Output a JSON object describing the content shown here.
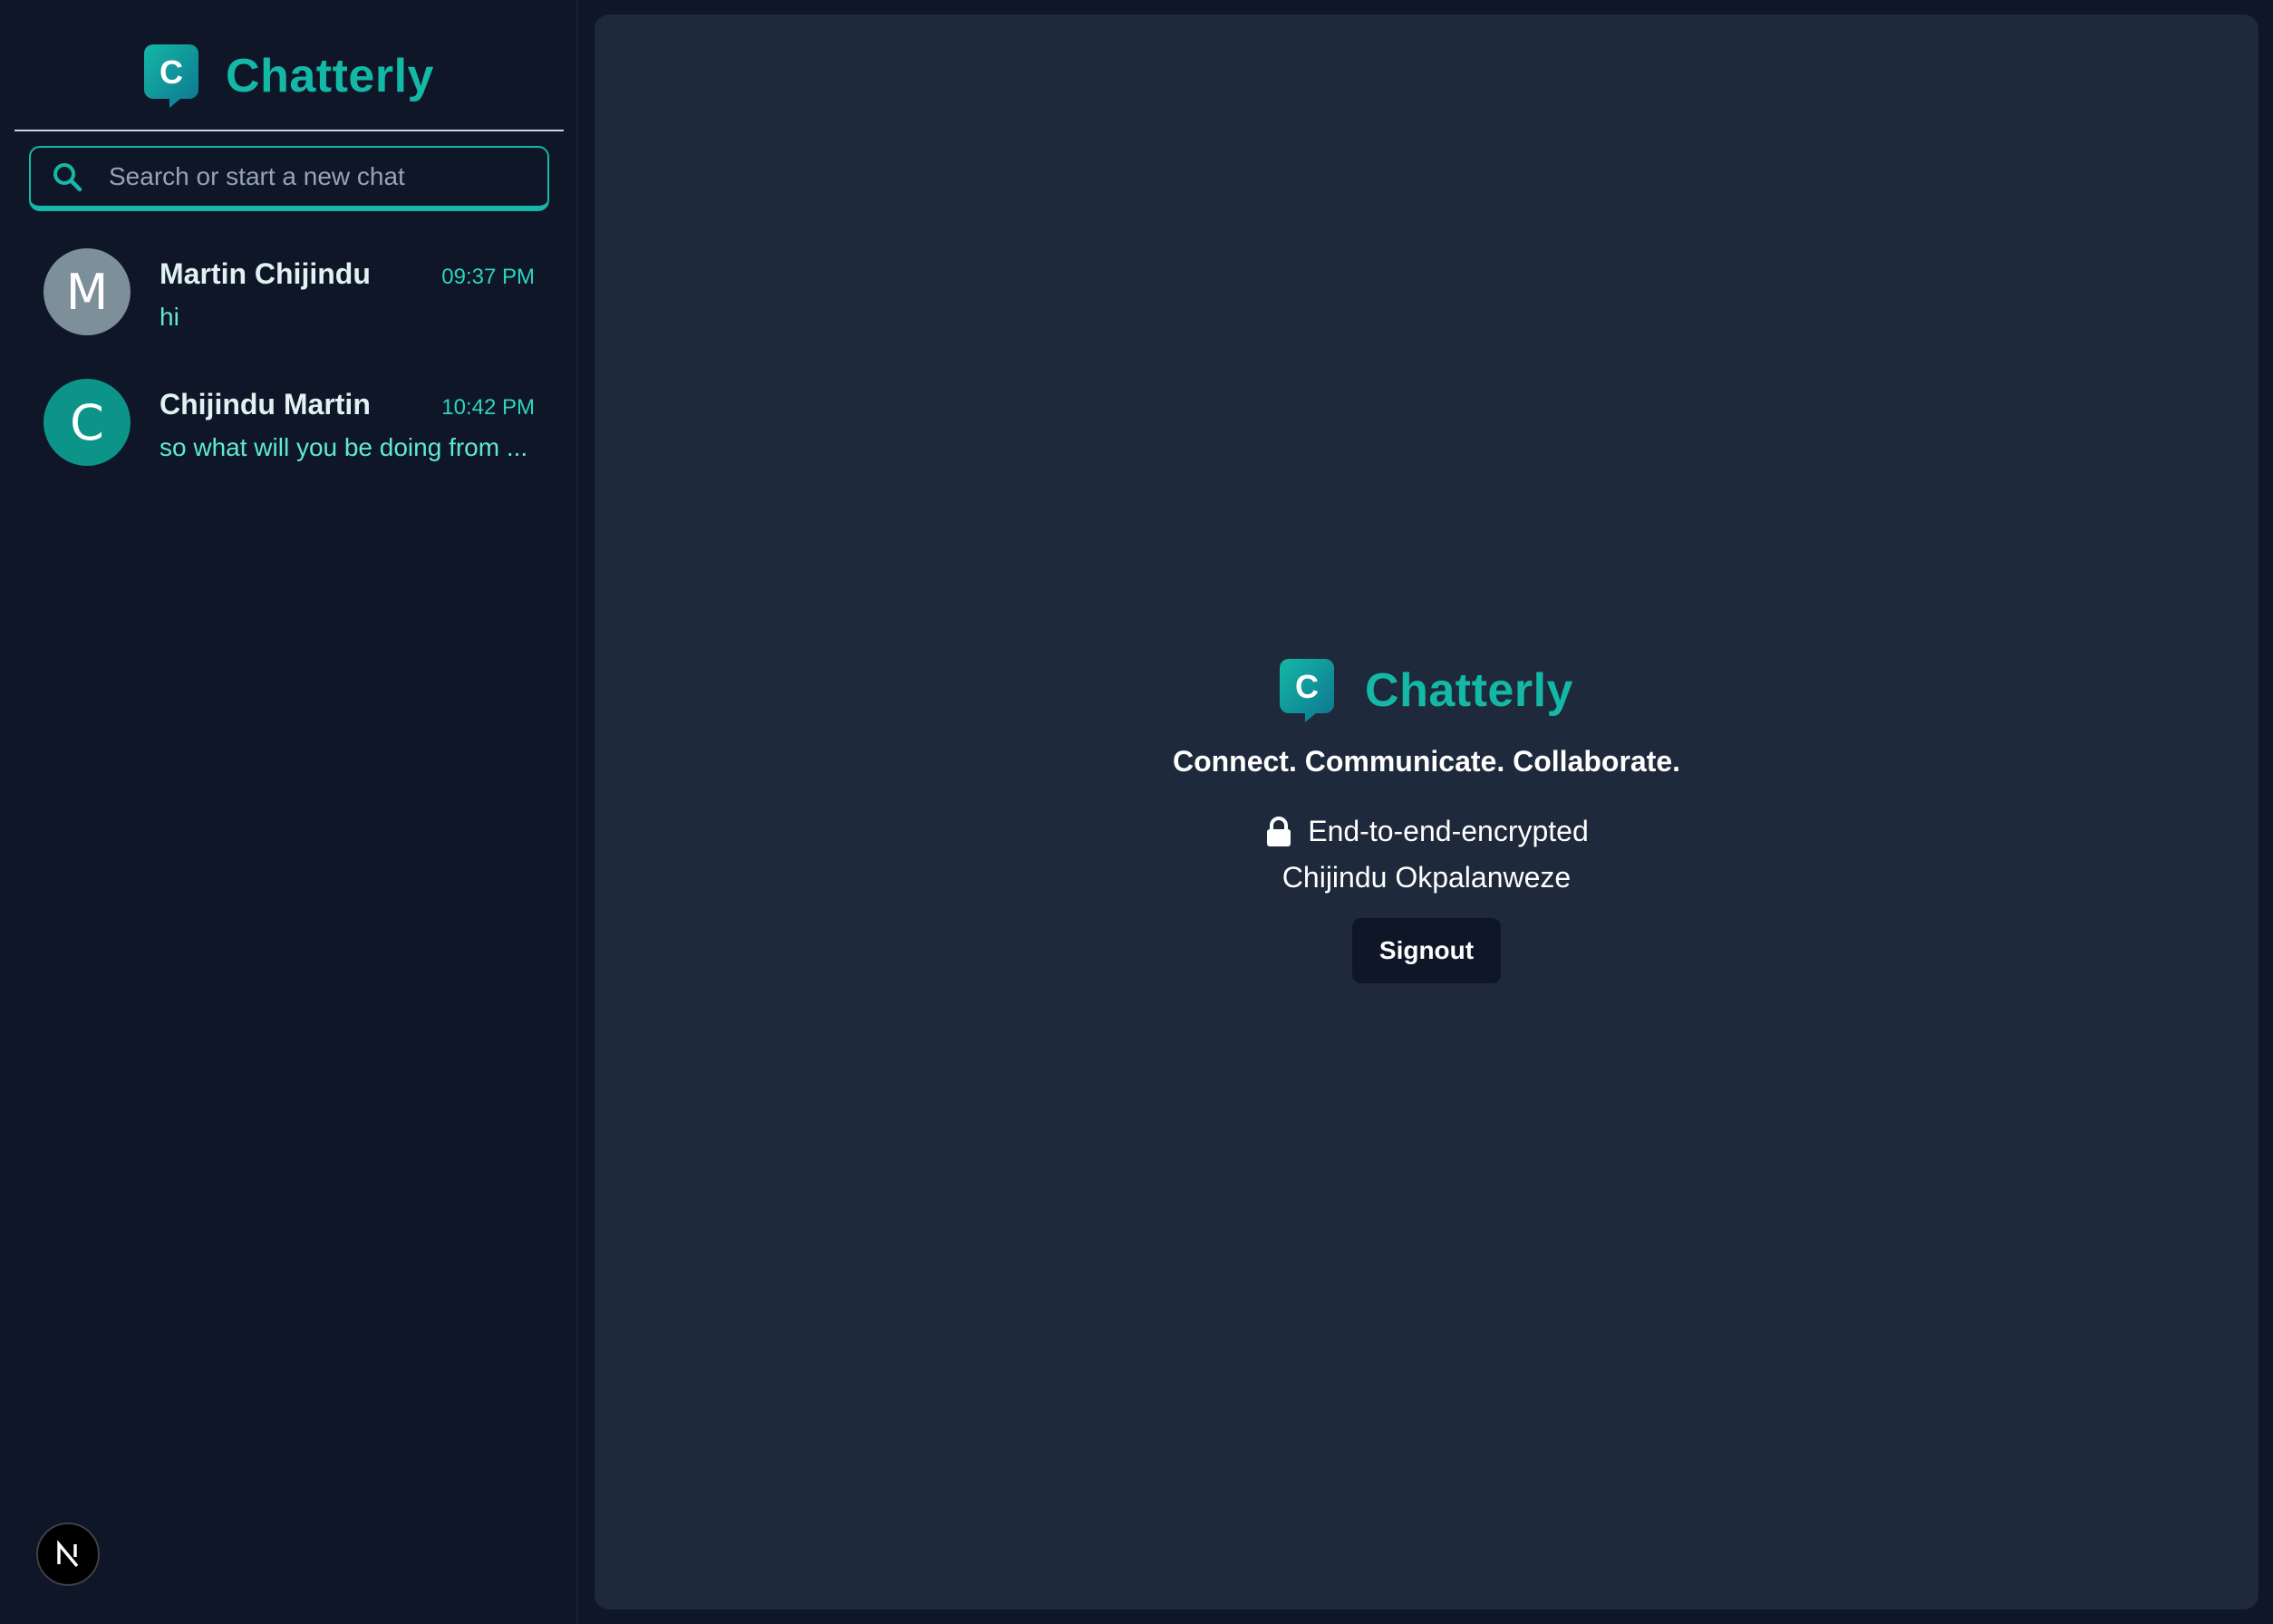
{
  "app": {
    "name": "Chatterly",
    "accent_color": "#14b8a6"
  },
  "sidebar": {
    "brand_name": "Chatterly",
    "logo_letter": "C",
    "search": {
      "placeholder": "Search or start a new chat",
      "value": ""
    },
    "chats": [
      {
        "initial": "M",
        "name": "Martin Chijindu",
        "time": "09:37 PM",
        "preview": "hi",
        "avatar_color": "#7d8f99"
      },
      {
        "initial": "C",
        "name": "Chijindu Martin",
        "time": "10:42 PM",
        "preview": "so what will you be doing from ...",
        "avatar_color": "#0d9488"
      }
    ],
    "dev_badge_letter": "N"
  },
  "main": {
    "brand_name": "Chatterly",
    "tagline": "Connect. Communicate. Collaborate.",
    "encryption_label": "End-to-end-encrypted",
    "user_name": "Chijindu Okpalanweze",
    "signout_label": "Signout"
  }
}
